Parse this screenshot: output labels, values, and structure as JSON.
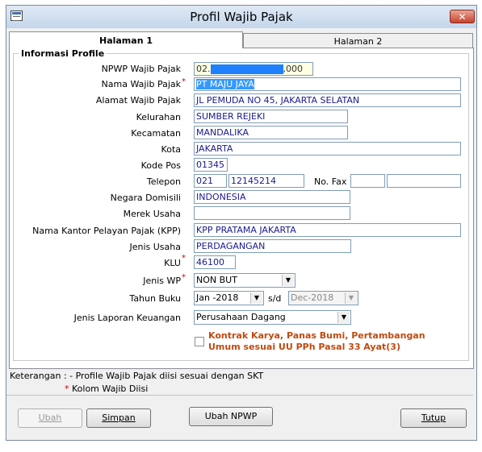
{
  "window": {
    "title": "Profil Wajib Pajak",
    "close_glyph": "✕"
  },
  "tabs": [
    {
      "label": "Halaman 1"
    },
    {
      "label": "Halaman 2"
    }
  ],
  "group_title": "Informasi Profile",
  "fields": {
    "npwp": {
      "label": "NPWP Wajib Pajak",
      "prefix": "02.",
      "suffix": ",000"
    },
    "nama": {
      "label": "Nama Wajib Pajak",
      "value": "PT MAJU JAYA"
    },
    "alamat": {
      "label": "Alamat Wajib Pajak",
      "value": "JL PEMUDA NO 45, JAKARTA SELATAN"
    },
    "kelurahan": {
      "label": "Kelurahan",
      "value": "SUMBER REJEKI"
    },
    "kecamatan": {
      "label": "Kecamatan",
      "value": "MANDALIKA"
    },
    "kota": {
      "label": "Kota",
      "value": "JAKARTA"
    },
    "kode_pos": {
      "label": "Kode Pos",
      "value": "01345"
    },
    "telepon": {
      "label": "Telepon",
      "area": "021",
      "number": "12145214"
    },
    "fax": {
      "label": "No. Fax",
      "area": "",
      "number": ""
    },
    "negara": {
      "label": "Negara Domisili",
      "value": "INDONESIA"
    },
    "merek": {
      "label": "Merek Usaha",
      "value": ""
    },
    "kpp": {
      "label": "Nama Kantor Pelayan Pajak (KPP)",
      "value": "KPP PRATAMA JAKARTA"
    },
    "jenis_usaha": {
      "label": "Jenis Usaha",
      "value": "PERDAGANGAN"
    },
    "klu": {
      "label": "KLU",
      "value": "46100"
    },
    "jenis_wp": {
      "label": "Jenis WP",
      "value": "NON BUT"
    },
    "tahun_buku": {
      "label": "Tahun Buku",
      "from": "Jan -2018",
      "sd": "s/d",
      "to": "Dec-2018"
    },
    "jenis_laporan": {
      "label": "Jenis Laporan Keuangan",
      "value": "Perusahaan Dagang"
    }
  },
  "checkbox": {
    "line1": "Kontrak Karya,  Panas Bumi, Pertambangan",
    "line2": "Umum sesuai UU PPh Pasal 33 Ayat(3)",
    "checked": false
  },
  "required_mark": "*",
  "notes": {
    "line1": "Keterangan : - Profile Wajib Pajak diisi sesuai dengan SKT",
    "line2": "Kolom Wajib Diisi"
  },
  "buttons": {
    "ubah": {
      "label": "Ubah",
      "enabled": false
    },
    "simpan": {
      "label": "Simpan"
    },
    "ubah_npwp": {
      "label": "Ubah NPWP"
    },
    "tutup": {
      "label": "Tutup"
    }
  },
  "colors": {
    "highlight": "#3399ff",
    "required": "#cc0000",
    "checkbox_text": "#c04a10",
    "npwp_mask": "#1e7fff"
  }
}
